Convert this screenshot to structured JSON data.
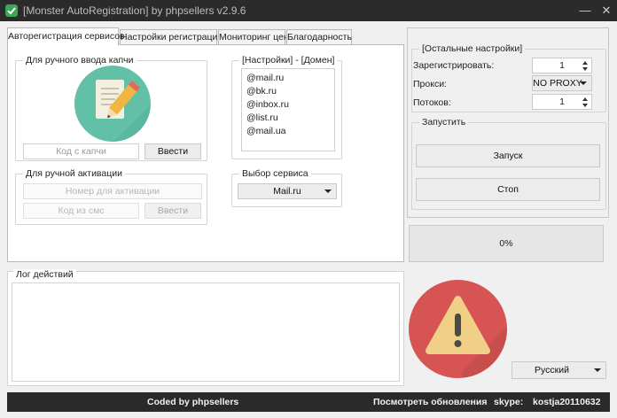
{
  "window": {
    "title": "[Monster AutoRegistration] by phpsellers v2.9.6",
    "minimize": "—",
    "close": "✕"
  },
  "tabs": [
    {
      "label": "Авторегистрация сервисов",
      "active": true
    },
    {
      "label": "Настройки регистрации",
      "active": false
    },
    {
      "label": "Мониторинг цен",
      "active": false
    },
    {
      "label": "Благодарность",
      "active": false
    }
  ],
  "captcha": {
    "legend": "Для ручного ввода капчи",
    "icon": "pencil-paper-icon",
    "input_placeholder": "Код с капчи",
    "submit": "Ввести"
  },
  "domains": {
    "legend": "[Настройки] - [Домен]",
    "items": [
      "@mail.ru",
      "@bk.ru",
      "@inbox.ru",
      "@list.ru",
      "@mail.ua"
    ]
  },
  "activation": {
    "legend": "Для ручной активации",
    "number_placeholder": "Номер для активации",
    "sms_placeholder": "Код из смс",
    "submit": "Ввести"
  },
  "service": {
    "legend": "Выбор сервиса",
    "selected": "Mail.ru"
  },
  "log": {
    "legend": "Лог действий",
    "content": ""
  },
  "other_settings": {
    "legend": "[Остальные настройки]",
    "register_label": "Зарегистрировать:",
    "register_value": "1",
    "proxy_label": "Прокси:",
    "proxy_value": "NO PROXY",
    "threads_label": "Потоков:",
    "threads_value": "1"
  },
  "launch": {
    "legend": "Запустить",
    "start": "Запуск",
    "stop": "Стоп"
  },
  "progress": {
    "text": "0%",
    "value": 0
  },
  "warning_icon": "warning-triangle-icon",
  "language": {
    "selected": "Русский"
  },
  "footer": {
    "coded_by": "Coded by phpsellers",
    "updates": "Посмотреть обновления",
    "skype_label": "skype:",
    "skype_value": "kostja20110632"
  },
  "colors": {
    "titlebar": "#2b2b2b",
    "captcha_circle": "#62c0a7",
    "warning_circle": "#d65454",
    "warning_triangle": "#f0cf86",
    "footer": "#2a2a2a"
  }
}
